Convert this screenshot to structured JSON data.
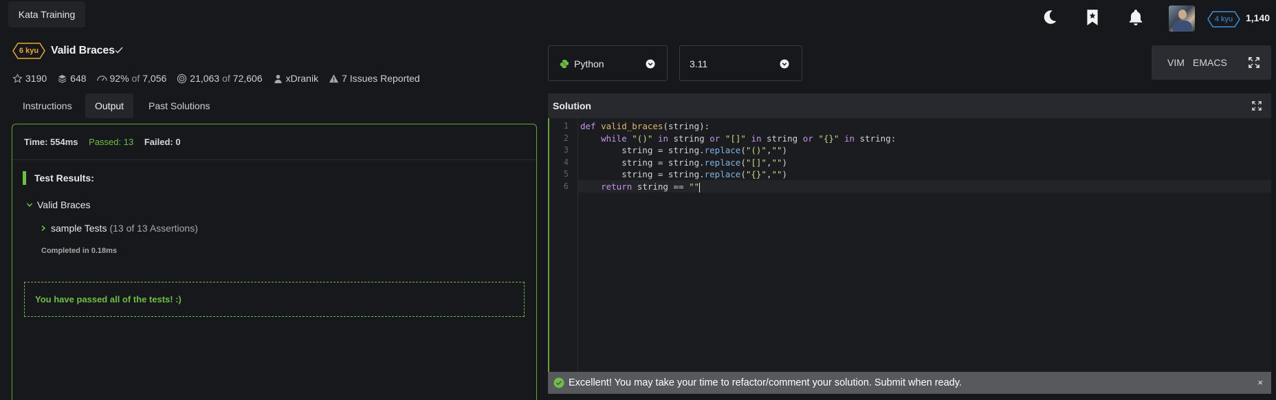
{
  "app": {
    "kata_training_label": "Kata Training",
    "honor": "1,140",
    "rank_badge": "4 kyu",
    "icons": {
      "theme": "moon-icon",
      "bookmark": "bookmark-star-icon",
      "notifications": "bell-icon"
    }
  },
  "kata": {
    "kyu": "6 kyu",
    "title": "Valid Braces",
    "stats": {
      "stars": "3190",
      "collections": "648",
      "satisfaction": "92%",
      "satisfaction_of": "of",
      "votes": "7,056",
      "completed": "21,063",
      "completed_of": "of",
      "attempts": "72,606",
      "author": "xDranik",
      "issues": "7 Issues Reported"
    }
  },
  "tabs": [
    {
      "label": "Instructions"
    },
    {
      "label": "Output",
      "active": true
    },
    {
      "label": "Past Solutions"
    }
  ],
  "output": {
    "time": "Time: 554ms",
    "passed": "Passed: 13",
    "failed": "Failed: 0",
    "results_title": "Test Results:",
    "group_name": "Valid Braces",
    "test_name": "sample Tests",
    "test_assertions": "(13 of 13 Assertions)",
    "completed": "Completed in 0.18ms",
    "passed_message": "You have passed all of the tests! :)"
  },
  "editor": {
    "language": "Python",
    "version": "3.11",
    "keymaps": [
      "VIM",
      "EMACS"
    ],
    "solution_label": "Solution",
    "line_numbers": [
      "1",
      "2",
      "3",
      "4",
      "5",
      "6"
    ],
    "code": [
      "def valid_braces(string):",
      "    while \"()\" in string or \"[]\" in string or \"{}\" in string:",
      "        string = string.replace(\"()\",\"\")",
      "        string = string.replace(\"[]\",\"\")",
      "        string = string.replace(\"{}\",\"\")",
      "    return string == \"\""
    ]
  },
  "toast": {
    "message": "Excellent! You may take your time to refactor/comment your solution. Submit when ready.",
    "close": "×"
  },
  "colors": {
    "accent_green": "#6ebf46",
    "kyu_orange": "#e8a838",
    "rank_blue": "#3d8fe0"
  }
}
